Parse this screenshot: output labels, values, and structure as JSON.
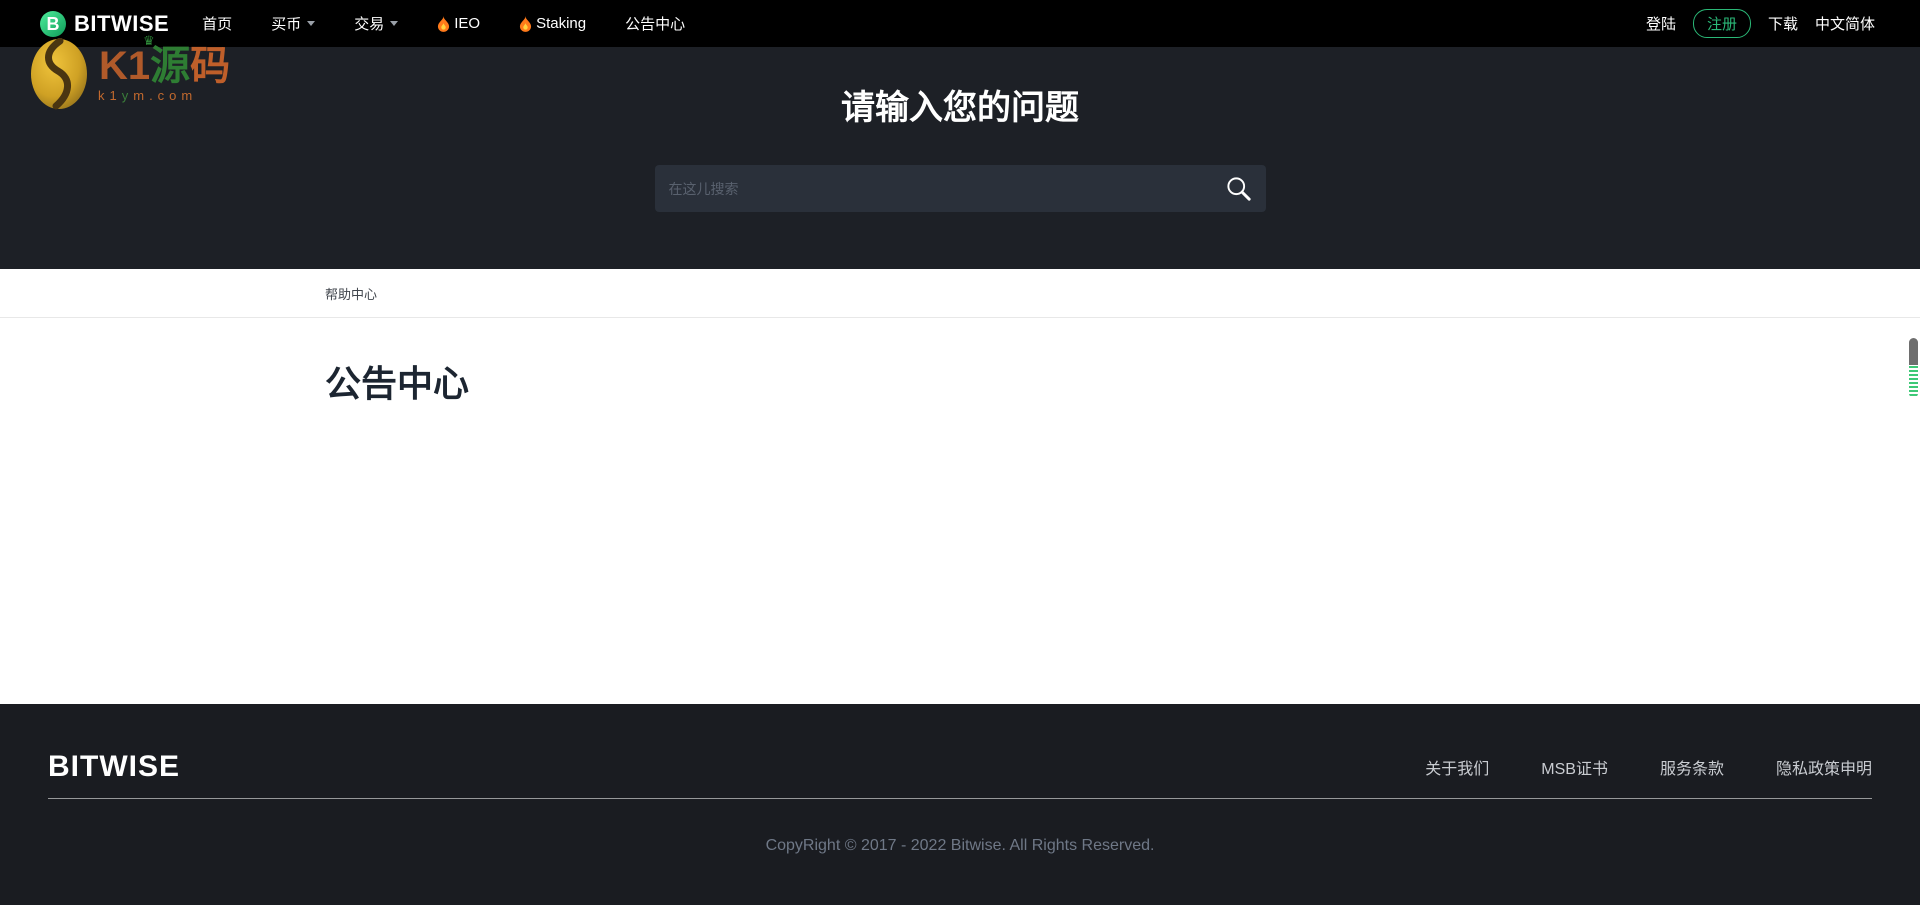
{
  "navbar": {
    "brand": "BITWISE",
    "items": [
      {
        "label": "首页"
      },
      {
        "label": "买币"
      },
      {
        "label": "交易"
      },
      {
        "label": "IEO"
      },
      {
        "label": "Staking"
      },
      {
        "label": "公告中心"
      }
    ],
    "login": "登陆",
    "register": "注册",
    "download": "下载",
    "language": "中文简体"
  },
  "watermark": {
    "brand_part1": "K1",
    "brand_part2": "源",
    "brand_part3": "码",
    "crown": "♛",
    "domain_part1": "k1",
    "domain_part2": "y",
    "domain_part3": "m.com"
  },
  "hero": {
    "title": "请输入您的问题",
    "search_placeholder": "在这儿搜索"
  },
  "breadcrumb": {
    "label": "帮助中心"
  },
  "main": {
    "title": "公告中心"
  },
  "footer": {
    "brand": "BITWISE",
    "links": [
      {
        "label": "关于我们"
      },
      {
        "label": "MSB证书"
      },
      {
        "label": "服务条款"
      },
      {
        "label": "隐私政策申明"
      }
    ],
    "copyright": "CopyRight © 2017 - 2022 Bitwise. All Rights Reserved."
  },
  "colors": {
    "accent_green": "#2bb877",
    "flame_orange": "#ff7a1a",
    "navbar_bg": "#000000",
    "hero_bg": "#1d2026",
    "search_bg": "#2a303a",
    "footer_bg": "#1a1c21",
    "watermark_orange": "#c2692e",
    "watermark_green": "#2e7d33",
    "scrollbar_stripe_green": "#3ec977"
  }
}
